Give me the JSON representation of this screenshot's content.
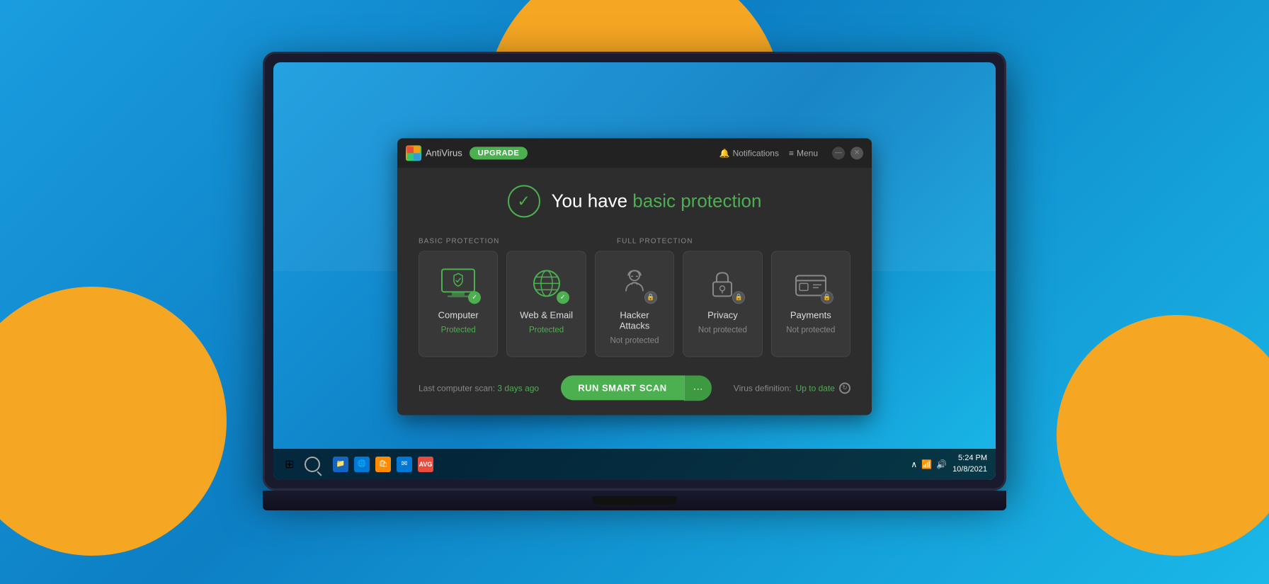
{
  "background": {
    "color": "#1a9de0"
  },
  "laptop": {
    "screen_content": "AVG AntiVirus application"
  },
  "titlebar": {
    "logo_text": "AVG",
    "app_name": "AntiVirus",
    "upgrade_label": "UPGRADE",
    "notifications_label": "Notifications",
    "menu_label": "Menu",
    "minimize_label": "—",
    "close_label": "✕"
  },
  "protection": {
    "headline": "You have ",
    "headline_highlight": "basic protection",
    "check_icon": "✓",
    "sections": {
      "basic_label": "BASIC PROTECTION",
      "full_label": "FULL PROTECTION"
    },
    "cards": [
      {
        "id": "computer",
        "name": "Computer",
        "status": "Protected",
        "is_protected": true,
        "icon_type": "monitor"
      },
      {
        "id": "web-email",
        "name": "Web & Email",
        "status": "Protected",
        "is_protected": true,
        "icon_type": "globe"
      },
      {
        "id": "hacker-attacks",
        "name": "Hacker Attacks",
        "status": "Not protected",
        "is_protected": false,
        "icon_type": "hacker"
      },
      {
        "id": "privacy",
        "name": "Privacy",
        "status": "Not protected",
        "is_protected": false,
        "icon_type": "lock"
      },
      {
        "id": "payments",
        "name": "Payments",
        "status": "Not protected",
        "is_protected": false,
        "icon_type": "card"
      }
    ]
  },
  "footer": {
    "last_scan_label": "Last computer scan: ",
    "last_scan_value": "3 days ago",
    "scan_button": "RUN SMART SCAN",
    "scan_more": "···",
    "virus_def_label": "Virus definition: ",
    "virus_def_value": "Up to date"
  },
  "taskbar": {
    "time": "5:24 PM",
    "date": "10/8/2021"
  }
}
